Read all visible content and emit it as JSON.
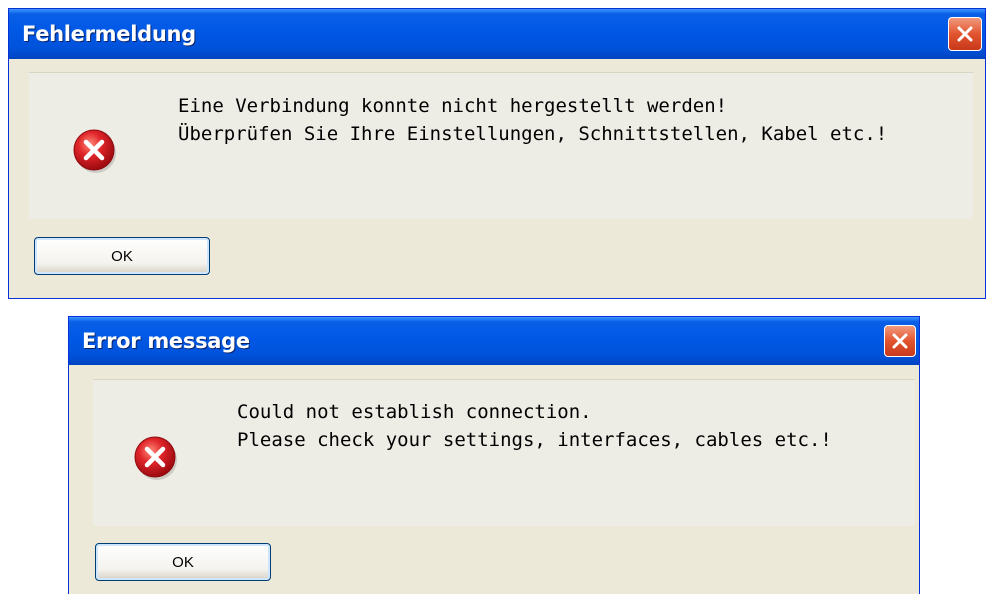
{
  "dialogs": [
    {
      "title": "Fehlermeldung",
      "icon": "error-icon",
      "message_lines": [
        "Eine Verbindung konnte nicht hergestellt werden!",
        "Überprüfen Sie Ihre Einstellungen, Schnittstellen, Kabel etc.!"
      ],
      "ok_label": "OK"
    },
    {
      "title": "Error message",
      "icon": "error-icon",
      "message_lines": [
        "Could not establish connection.",
        "Please check your settings, interfaces, cables etc.!"
      ],
      "ok_label": "OK"
    }
  ],
  "colors": {
    "titlebar": "#0058e6",
    "dialog_bg": "#ece9d8",
    "close_button": "#e2542f",
    "error_icon": "#d4171c"
  }
}
